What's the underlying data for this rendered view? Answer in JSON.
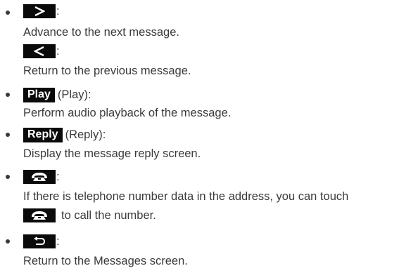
{
  "items": [
    {
      "buttons": [
        {
          "icon": "chevron-right-icon",
          "suffix": ":",
          "description": "Advance to the next message."
        },
        {
          "icon": "chevron-left-icon",
          "suffix": ":",
          "description": "Return to the previous message."
        }
      ]
    },
    {
      "label": "Play",
      "suffix": "(Play):",
      "description": "Perform audio playback of the message."
    },
    {
      "label": "Reply",
      "suffix": "(Reply):",
      "description": "Display the message reply screen."
    },
    {
      "icon": "phone-icon",
      "suffix": ":",
      "description_line1": "If there is telephone number data in the address, you can touch",
      "description_line2": "to call the number."
    },
    {
      "icon": "return-arrow-icon",
      "suffix": ":",
      "description": "Return to the Messages screen."
    }
  ],
  "colors": {
    "text": "#3a3a3a",
    "button_bg": "#0a0a0a",
    "button_fg": "#ffffff"
  }
}
